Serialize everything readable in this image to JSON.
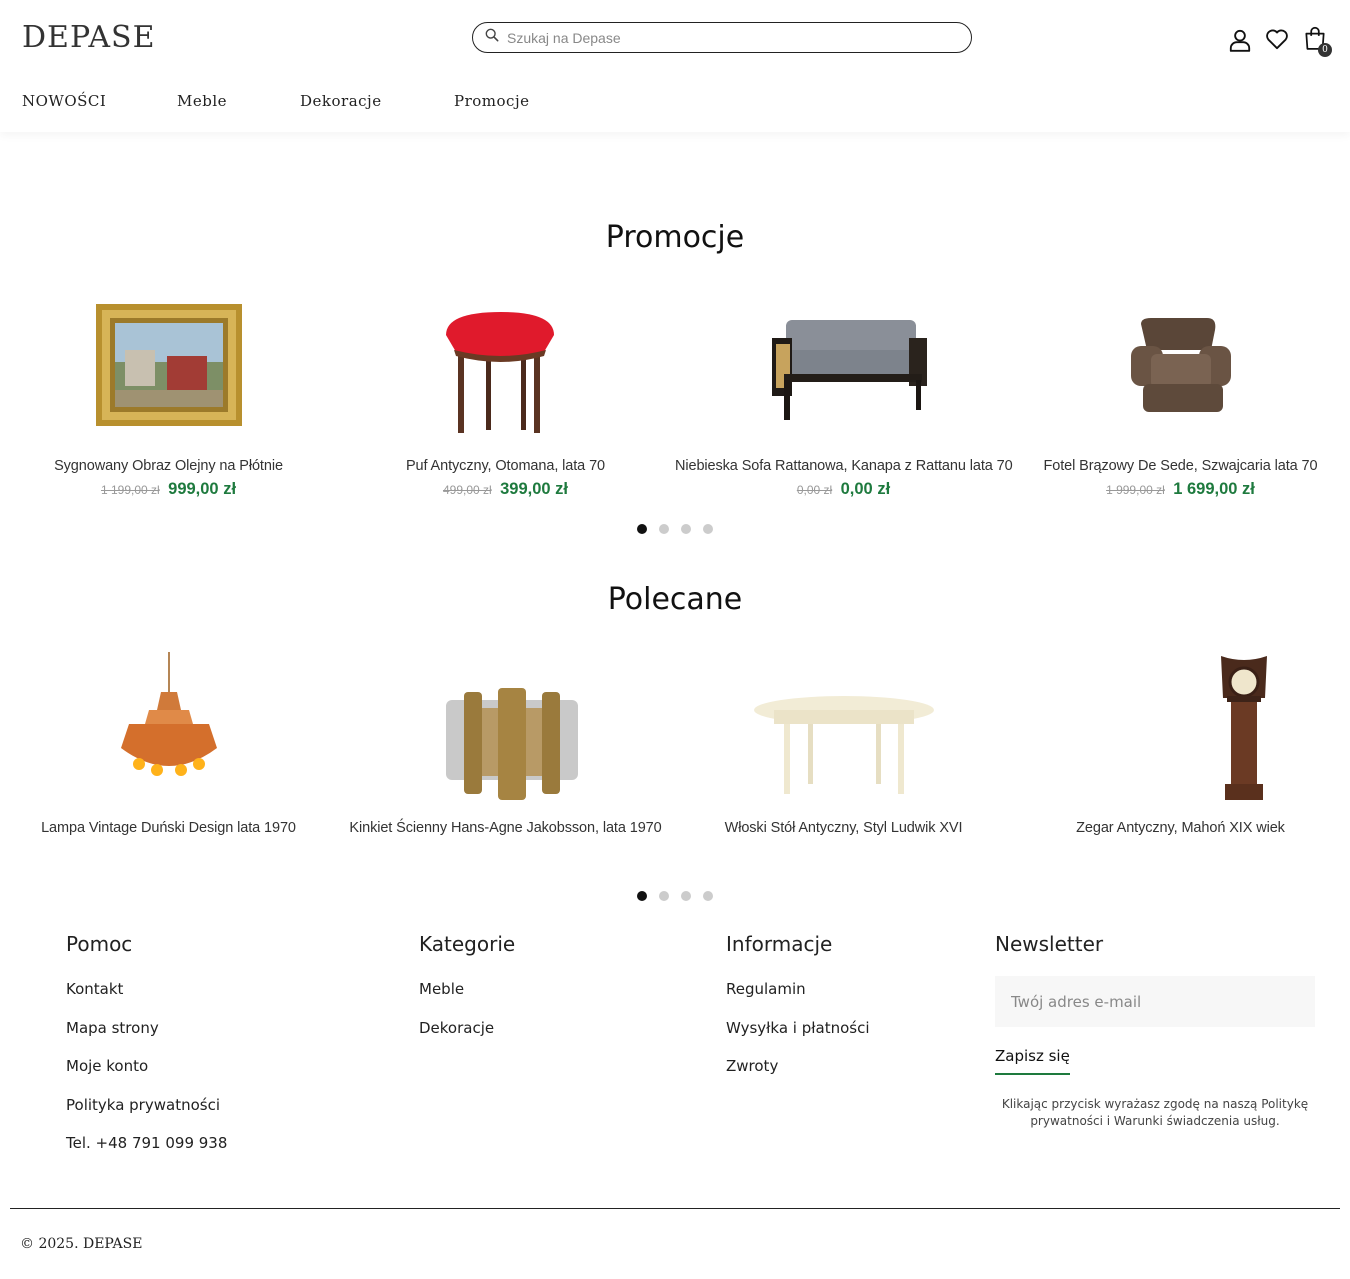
{
  "header": {
    "logo": "DEPASE",
    "search_placeholder": "Szukaj na Depase",
    "cart_count": "0"
  },
  "nav": [
    "NOWOŚCI",
    "Meble",
    "Dekoracje",
    "Promocje"
  ],
  "promocje": {
    "title": "Promocje",
    "products": [
      {
        "name": "Sygnowany Obraz Olejny na Płótnie",
        "old_price": "1 199,00 zł",
        "price": "999,00 zł"
      },
      {
        "name": "Puf Antyczny, Otomana, lata 70",
        "old_price": "499,00 zł",
        "price": "399,00 zł"
      },
      {
        "name": "Niebieska Sofa Rattanowa, Kanapa z Rattanu lata 70",
        "old_price": "0,00 zł",
        "price": "0,00 zł"
      },
      {
        "name": "Fotel Brązowy De Sede, Szwajcaria lata 70",
        "old_price": "1 999,00 zł",
        "price": "1 699,00 zł"
      }
    ]
  },
  "polecane": {
    "title": "Polecane",
    "products": [
      {
        "name": "Lampa Vintage Duński Design lata 1970"
      },
      {
        "name": "Kinkiet Ścienny Hans-Agne Jakobsson, lata 1970"
      },
      {
        "name": "Włoski Stół Antyczny, Styl Ludwik XVI"
      },
      {
        "name": "Zegar Antyczny, Mahoń XIX wiek"
      }
    ]
  },
  "footer": {
    "pomoc": {
      "title": "Pomoc",
      "links": [
        "Kontakt",
        "Mapa strony",
        "Moje konto",
        "Polityka prywatności",
        "Tel. +48 791 099 938"
      ]
    },
    "kategorie": {
      "title": "Kategorie",
      "links": [
        "Meble",
        "Dekoracje"
      ]
    },
    "informacje": {
      "title": "Informacje",
      "links": [
        "Regulamin",
        "Wysyłka i płatności",
        "Zwroty"
      ]
    },
    "newsletter": {
      "title": "Newsletter",
      "email_placeholder": "Twój adres e-mail",
      "button": "Zapisz się",
      "note": "Klikając przycisk wyrażasz zgodę na naszą Politykę prywatności i Warunki świadczenia usług."
    },
    "copyright": "© 2025. DEPASE"
  },
  "colors": {
    "price_green": "#1e7a3e",
    "accent": "#111111"
  },
  "icons": [
    "search-icon",
    "user-icon",
    "heart-icon",
    "bag-icon"
  ]
}
